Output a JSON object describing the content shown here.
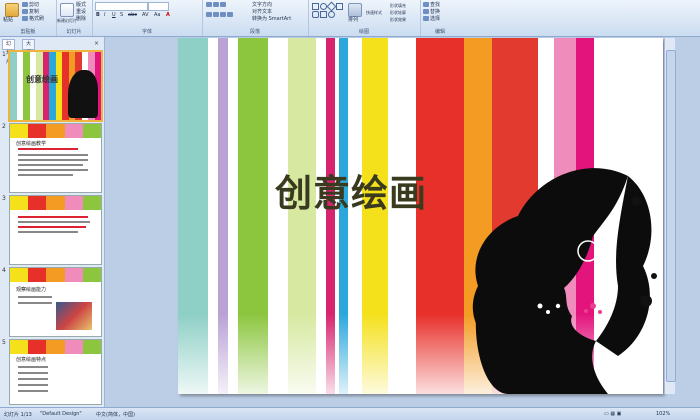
{
  "ribbon": {
    "groups": [
      {
        "label": "剪贴板",
        "buttons": [
          "粘贴",
          "剪切",
          "复制",
          "格式刷"
        ]
      },
      {
        "label": "幻灯片",
        "buttons": [
          "新建幻灯片",
          "版式",
          "重设",
          "删除"
        ]
      },
      {
        "label": "字体",
        "buttons": [
          "B",
          "I",
          "U",
          "S",
          "abc",
          "AV",
          "Aa",
          "A"
        ]
      },
      {
        "label": "段落",
        "buttons": [
          "文字方向",
          "对齐文本",
          "转换为 SmartArt"
        ]
      },
      {
        "label": "绘图",
        "buttons": [
          "排列",
          "快速样式",
          "形状填充",
          "形状轮廓",
          "形状效果"
        ]
      },
      {
        "label": "编辑",
        "buttons": [
          "查找",
          "替换",
          "选择"
        ]
      }
    ]
  },
  "left_pane": {
    "tabs": [
      "幻灯片",
      "大纲"
    ],
    "close_symbol": "×",
    "slides": [
      {
        "num": "1",
        "title": "创意绘画"
      },
      {
        "num": "2",
        "title": "创意绘画教学"
      },
      {
        "num": "3",
        "title": ""
      },
      {
        "num": "4",
        "title": "观察绘画能力"
      },
      {
        "num": "5",
        "title": "创意绘画特点"
      }
    ]
  },
  "slide": {
    "title": "创意绘画",
    "stripe_colors": [
      "#8ecfc6",
      "#ffffff",
      "#b9a2d6",
      "#ffffff",
      "#8cc63f",
      "#ffffff",
      "#d7e9a1",
      "#ffffff",
      "#d8246e",
      "#ffffff",
      "#2aa8dc",
      "#ffffff",
      "#f4e11c",
      "#ffffff",
      "#e8302a",
      "#f39b22",
      "#e23a2f",
      "#ffffff",
      "#f08cbc",
      "#e3157d",
      "#ffffff"
    ]
  },
  "status": {
    "slide_info": "幻灯片 1/13",
    "theme": "\"Default Design\"",
    "language": "中文(简体，中国)",
    "zoom": "102%"
  }
}
